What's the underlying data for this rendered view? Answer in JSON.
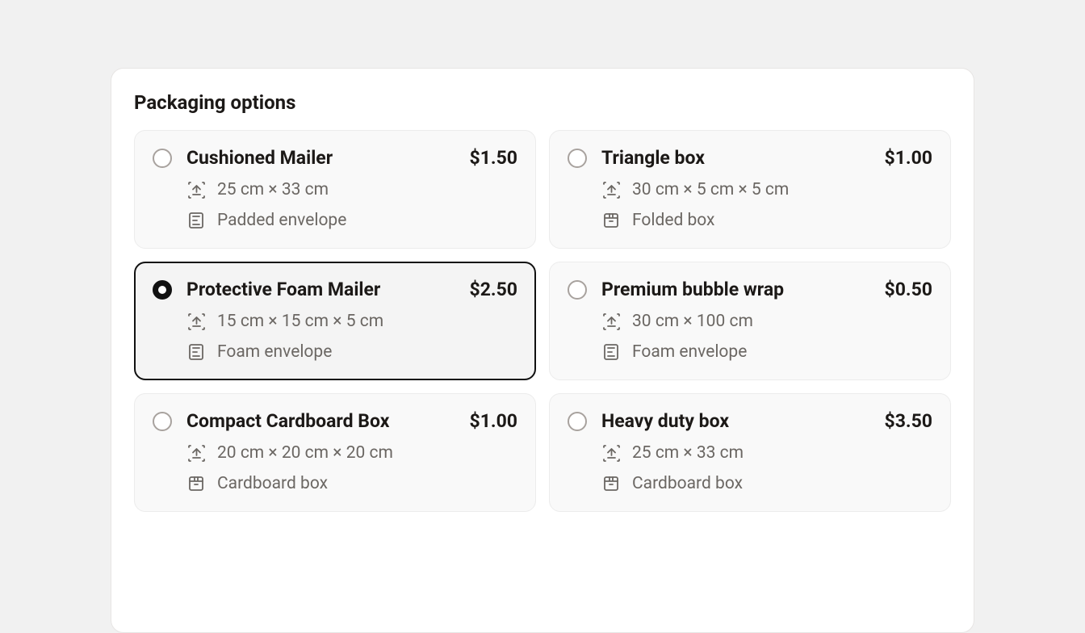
{
  "title": "Packaging options",
  "options": [
    {
      "name": "Cushioned Mailer",
      "price": "$1.50",
      "dimensions": "25 cm × 33 cm",
      "type": "Padded envelope",
      "type_icon": "envelope",
      "selected": false
    },
    {
      "name": "Triangle box",
      "price": "$1.00",
      "dimensions": "30 cm × 5 cm × 5 cm",
      "type": "Folded box",
      "type_icon": "box",
      "selected": false
    },
    {
      "name": "Protective Foam Mailer",
      "price": "$2.50",
      "dimensions": "15 cm × 15 cm × 5 cm",
      "type": "Foam envelope",
      "type_icon": "envelope",
      "selected": true
    },
    {
      "name": "Premium bubble wrap",
      "price": "$0.50",
      "dimensions": "30 cm × 100 cm",
      "type": "Foam envelope",
      "type_icon": "envelope",
      "selected": false
    },
    {
      "name": "Compact Cardboard Box",
      "price": "$1.00",
      "dimensions": "20 cm × 20 cm × 20 cm",
      "type": "Cardboard box",
      "type_icon": "box",
      "selected": false
    },
    {
      "name": "Heavy duty box",
      "price": "$3.50",
      "dimensions": "25 cm × 33 cm",
      "type": "Cardboard box",
      "type_icon": "box",
      "selected": false
    }
  ]
}
